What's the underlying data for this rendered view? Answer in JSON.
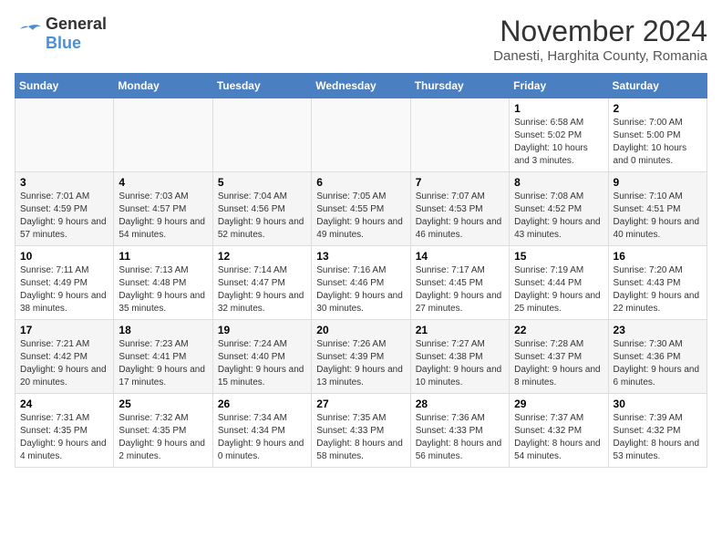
{
  "logo": {
    "text_general": "General",
    "text_blue": "Blue"
  },
  "title": "November 2024",
  "subtitle": "Danesti, Harghita County, Romania",
  "days_of_week": [
    "Sunday",
    "Monday",
    "Tuesday",
    "Wednesday",
    "Thursday",
    "Friday",
    "Saturday"
  ],
  "weeks": [
    [
      {
        "day": "",
        "info": ""
      },
      {
        "day": "",
        "info": ""
      },
      {
        "day": "",
        "info": ""
      },
      {
        "day": "",
        "info": ""
      },
      {
        "day": "",
        "info": ""
      },
      {
        "day": "1",
        "info": "Sunrise: 6:58 AM\nSunset: 5:02 PM\nDaylight: 10 hours and 3 minutes."
      },
      {
        "day": "2",
        "info": "Sunrise: 7:00 AM\nSunset: 5:00 PM\nDaylight: 10 hours and 0 minutes."
      }
    ],
    [
      {
        "day": "3",
        "info": "Sunrise: 7:01 AM\nSunset: 4:59 PM\nDaylight: 9 hours and 57 minutes."
      },
      {
        "day": "4",
        "info": "Sunrise: 7:03 AM\nSunset: 4:57 PM\nDaylight: 9 hours and 54 minutes."
      },
      {
        "day": "5",
        "info": "Sunrise: 7:04 AM\nSunset: 4:56 PM\nDaylight: 9 hours and 52 minutes."
      },
      {
        "day": "6",
        "info": "Sunrise: 7:05 AM\nSunset: 4:55 PM\nDaylight: 9 hours and 49 minutes."
      },
      {
        "day": "7",
        "info": "Sunrise: 7:07 AM\nSunset: 4:53 PM\nDaylight: 9 hours and 46 minutes."
      },
      {
        "day": "8",
        "info": "Sunrise: 7:08 AM\nSunset: 4:52 PM\nDaylight: 9 hours and 43 minutes."
      },
      {
        "day": "9",
        "info": "Sunrise: 7:10 AM\nSunset: 4:51 PM\nDaylight: 9 hours and 40 minutes."
      }
    ],
    [
      {
        "day": "10",
        "info": "Sunrise: 7:11 AM\nSunset: 4:49 PM\nDaylight: 9 hours and 38 minutes."
      },
      {
        "day": "11",
        "info": "Sunrise: 7:13 AM\nSunset: 4:48 PM\nDaylight: 9 hours and 35 minutes."
      },
      {
        "day": "12",
        "info": "Sunrise: 7:14 AM\nSunset: 4:47 PM\nDaylight: 9 hours and 32 minutes."
      },
      {
        "day": "13",
        "info": "Sunrise: 7:16 AM\nSunset: 4:46 PM\nDaylight: 9 hours and 30 minutes."
      },
      {
        "day": "14",
        "info": "Sunrise: 7:17 AM\nSunset: 4:45 PM\nDaylight: 9 hours and 27 minutes."
      },
      {
        "day": "15",
        "info": "Sunrise: 7:19 AM\nSunset: 4:44 PM\nDaylight: 9 hours and 25 minutes."
      },
      {
        "day": "16",
        "info": "Sunrise: 7:20 AM\nSunset: 4:43 PM\nDaylight: 9 hours and 22 minutes."
      }
    ],
    [
      {
        "day": "17",
        "info": "Sunrise: 7:21 AM\nSunset: 4:42 PM\nDaylight: 9 hours and 20 minutes."
      },
      {
        "day": "18",
        "info": "Sunrise: 7:23 AM\nSunset: 4:41 PM\nDaylight: 9 hours and 17 minutes."
      },
      {
        "day": "19",
        "info": "Sunrise: 7:24 AM\nSunset: 4:40 PM\nDaylight: 9 hours and 15 minutes."
      },
      {
        "day": "20",
        "info": "Sunrise: 7:26 AM\nSunset: 4:39 PM\nDaylight: 9 hours and 13 minutes."
      },
      {
        "day": "21",
        "info": "Sunrise: 7:27 AM\nSunset: 4:38 PM\nDaylight: 9 hours and 10 minutes."
      },
      {
        "day": "22",
        "info": "Sunrise: 7:28 AM\nSunset: 4:37 PM\nDaylight: 9 hours and 8 minutes."
      },
      {
        "day": "23",
        "info": "Sunrise: 7:30 AM\nSunset: 4:36 PM\nDaylight: 9 hours and 6 minutes."
      }
    ],
    [
      {
        "day": "24",
        "info": "Sunrise: 7:31 AM\nSunset: 4:35 PM\nDaylight: 9 hours and 4 minutes."
      },
      {
        "day": "25",
        "info": "Sunrise: 7:32 AM\nSunset: 4:35 PM\nDaylight: 9 hours and 2 minutes."
      },
      {
        "day": "26",
        "info": "Sunrise: 7:34 AM\nSunset: 4:34 PM\nDaylight: 9 hours and 0 minutes."
      },
      {
        "day": "27",
        "info": "Sunrise: 7:35 AM\nSunset: 4:33 PM\nDaylight: 8 hours and 58 minutes."
      },
      {
        "day": "28",
        "info": "Sunrise: 7:36 AM\nSunset: 4:33 PM\nDaylight: 8 hours and 56 minutes."
      },
      {
        "day": "29",
        "info": "Sunrise: 7:37 AM\nSunset: 4:32 PM\nDaylight: 8 hours and 54 minutes."
      },
      {
        "day": "30",
        "info": "Sunrise: 7:39 AM\nSunset: 4:32 PM\nDaylight: 8 hours and 53 minutes."
      }
    ]
  ]
}
